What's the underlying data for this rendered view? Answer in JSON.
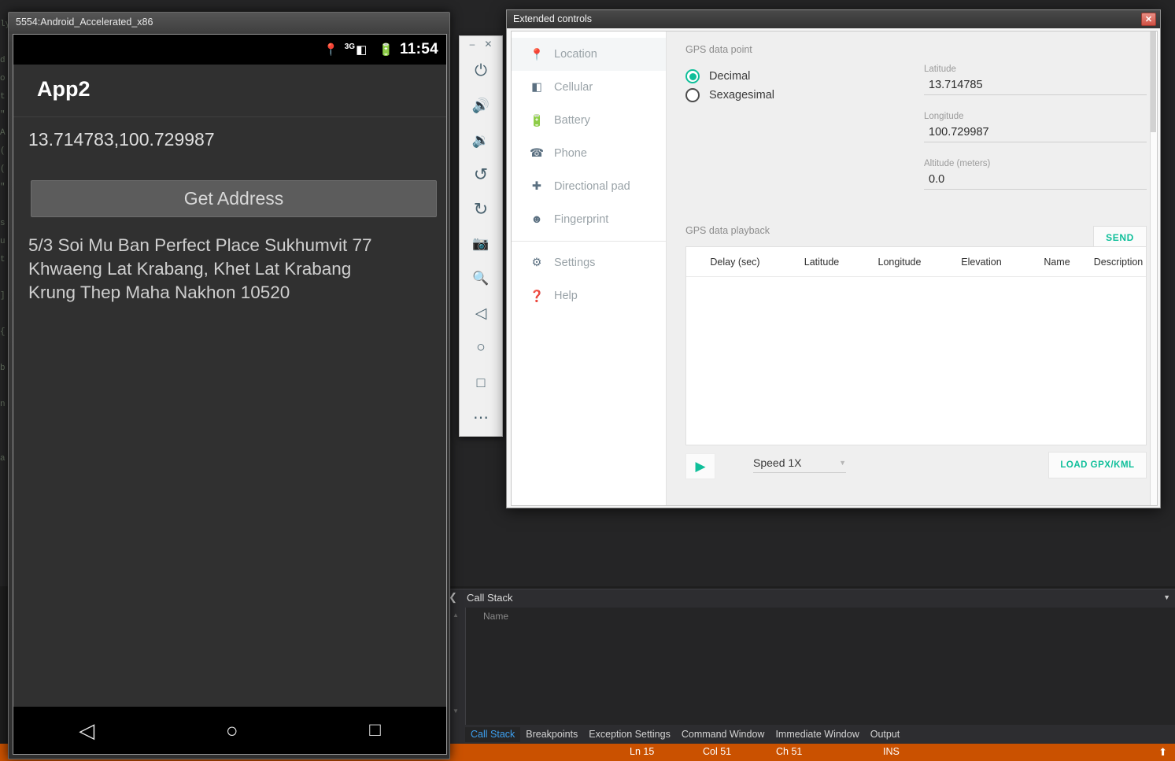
{
  "vs": {
    "gutter_code": "ly\n\nd\no\nt\n\"\nA\n(\n(\n\"\n\ns\nu\nt\n\n]\n\n{\n\nb\n\nn\n\n\na",
    "call_stack": {
      "panel_title": "Call Stack",
      "close_icon": "close-icon",
      "chevron_icon": "chevron-down-icon",
      "column_name": "Name",
      "tabs": [
        {
          "label": "Call Stack",
          "active": true
        },
        {
          "label": "Breakpoints",
          "active": false
        },
        {
          "label": "Exception Settings",
          "active": false
        },
        {
          "label": "Command Window",
          "active": false
        },
        {
          "label": "Immediate Window",
          "active": false
        },
        {
          "label": "Output",
          "active": false
        }
      ]
    },
    "status_bar": {
      "line": "Ln 15",
      "column": "Col 51",
      "character": "Ch 51",
      "insert_mode": "INS",
      "arrow_icon": "arrow-up-icon",
      "accent_color": "#ca5100"
    }
  },
  "emulator": {
    "window_title": "5554:Android_Accelerated_x86",
    "status_bar": {
      "location_icon": "location-pin-icon",
      "network": "3G",
      "signal_icon": "signal-bars-icon",
      "battery_icon": "battery-charging-icon",
      "clock": "11:54"
    },
    "app": {
      "title": "App2",
      "coordinates": "13.714783,100.729987",
      "get_address_button": "Get Address",
      "address_lines": [
        "5/3 Soi Mu Ban Perfect Place Sukhumvit 77",
        "Khwaeng Lat Krabang, Khet Lat Krabang",
        "Krung Thep Maha Nakhon 10520"
      ]
    },
    "nav_bar": [
      {
        "name": "back-button",
        "glyph": "◁"
      },
      {
        "name": "home-button",
        "glyph": "○"
      },
      {
        "name": "recents-button",
        "glyph": "□"
      }
    ]
  },
  "emulator_toolbar": {
    "minimize_label": "–",
    "close_label": "✕",
    "items": [
      {
        "name": "power-icon",
        "glyph": "⏻"
      },
      {
        "name": "volume-up-icon",
        "glyph": "🔊"
      },
      {
        "name": "volume-down-icon",
        "glyph": "🔉"
      },
      {
        "name": "rotate-left-icon",
        "glyph": "↺"
      },
      {
        "name": "rotate-right-icon",
        "glyph": "↻"
      },
      {
        "name": "screenshot-icon",
        "glyph": "📷"
      },
      {
        "name": "zoom-icon",
        "glyph": "🔍"
      },
      {
        "name": "back-icon",
        "glyph": "◁"
      },
      {
        "name": "home-icon",
        "glyph": "○"
      },
      {
        "name": "overview-icon",
        "glyph": "□"
      },
      {
        "name": "more-icon",
        "glyph": "⋯"
      }
    ]
  },
  "extended_controls": {
    "title": "Extended controls",
    "close_label": "✕",
    "sidebar": [
      {
        "label": "Location",
        "icon": "location-pin-icon",
        "selected": true
      },
      {
        "label": "Cellular",
        "icon": "cellular-icon",
        "selected": false
      },
      {
        "label": "Battery",
        "icon": "battery-icon",
        "selected": false
      },
      {
        "label": "Phone",
        "icon": "phone-icon",
        "selected": false
      },
      {
        "label": "Directional pad",
        "icon": "dpad-icon",
        "selected": false
      },
      {
        "label": "Fingerprint",
        "icon": "fingerprint-icon",
        "selected": false
      },
      {
        "label": "Settings",
        "icon": "gear-icon",
        "selected": false
      },
      {
        "label": "Help",
        "icon": "help-icon",
        "selected": false
      }
    ],
    "gps_data_point": {
      "section_label": "GPS data point",
      "format_options": [
        {
          "label": "Decimal",
          "selected": true
        },
        {
          "label": "Sexagesimal",
          "selected": false
        }
      ],
      "latitude_label": "Latitude",
      "latitude_value": "13.714785",
      "longitude_label": "Longitude",
      "longitude_value": "100.729987",
      "altitude_label": "Altitude (meters)",
      "altitude_value": "0.0",
      "send_button": "SEND"
    },
    "gps_data_playback": {
      "section_label": "GPS data playback",
      "columns": [
        "Delay (sec)",
        "Latitude",
        "Longitude",
        "Elevation",
        "Name",
        "Description"
      ],
      "rows": [],
      "play_icon": "play-icon",
      "speed_label": "Speed 1X",
      "speed_caret_icon": "chevron-down-icon",
      "load_button": "LOAD GPX/KML"
    },
    "accent_color": "#0fbf9a"
  }
}
